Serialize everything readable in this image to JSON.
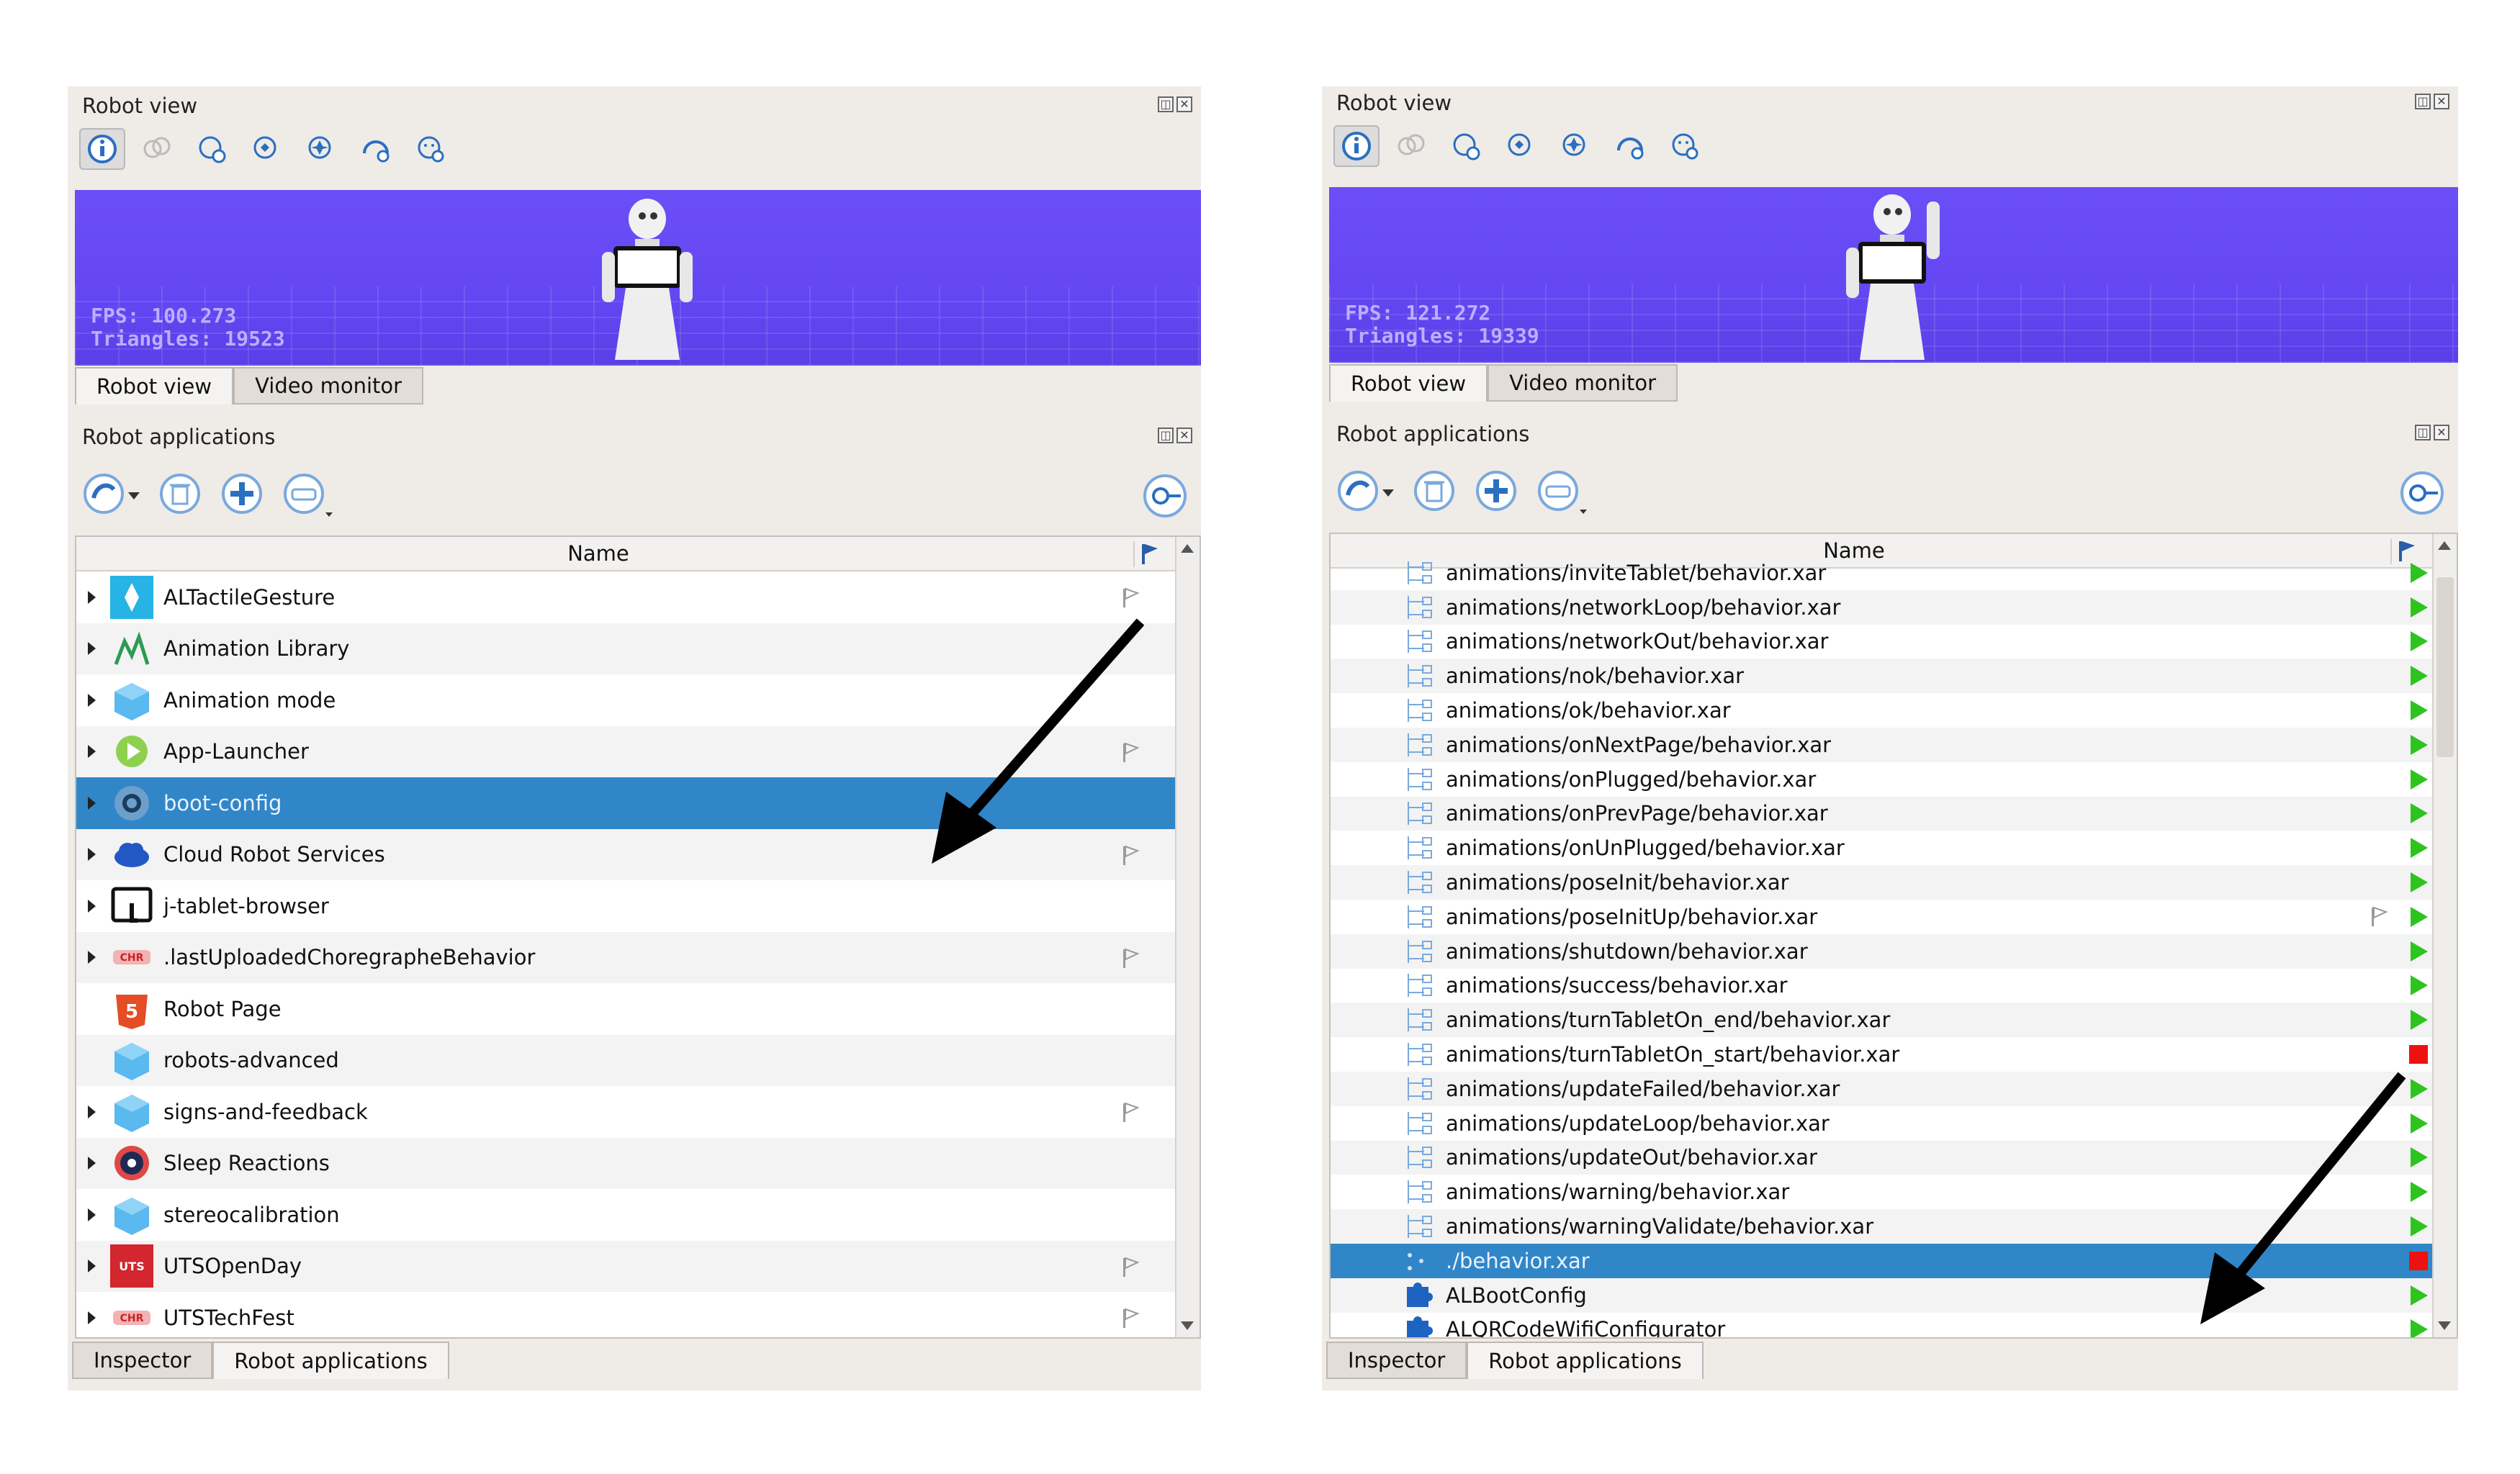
{
  "left": {
    "robot_view_title": "Robot view",
    "fps": "FPS: 100.273",
    "triangles": "Triangles: 19523",
    "tabs_top": [
      "Robot view",
      "Video monitor"
    ],
    "apps_title": "Robot applications",
    "column_name": "Name",
    "apps": [
      {
        "label": "ALTactileGesture",
        "icon": "tactile-gesture-icon",
        "expandable": true,
        "flag": true
      },
      {
        "label": "Animation Library",
        "icon": "animation-library-icon",
        "expandable": true,
        "flag": false
      },
      {
        "label": "Animation mode",
        "icon": "cube-icon",
        "expandable": true,
        "flag": false
      },
      {
        "label": "App-Launcher",
        "icon": "app-launcher-icon",
        "expandable": true,
        "flag": true
      },
      {
        "label": "boot-config",
        "icon": "gear-icon",
        "expandable": true,
        "flag": false,
        "selected": true
      },
      {
        "label": "Cloud Robot Services",
        "icon": "cloud-icon",
        "expandable": true,
        "flag": true
      },
      {
        "label": "j-tablet-browser",
        "icon": "tablet-touch-icon",
        "expandable": true,
        "flag": false
      },
      {
        "label": ".lastUploadedChoregrapheBehavior",
        "icon": "choregraphe-icon",
        "expandable": true,
        "flag": true
      },
      {
        "label": "Robot Page",
        "icon": "html5-icon",
        "expandable": false,
        "flag": false
      },
      {
        "label": "robots-advanced",
        "icon": "cube-icon",
        "expandable": false,
        "flag": false
      },
      {
        "label": "signs-and-feedback",
        "icon": "cube-icon",
        "expandable": true,
        "flag": true
      },
      {
        "label": "Sleep Reactions",
        "icon": "sleep-reactions-icon",
        "expandable": true,
        "flag": false
      },
      {
        "label": "stereocalibration",
        "icon": "cube-icon",
        "expandable": true,
        "flag": false
      },
      {
        "label": "UTSOpenDay",
        "icon": "uts-icon",
        "expandable": true,
        "flag": true
      },
      {
        "label": "UTSTechFest",
        "icon": "choregraphe-icon",
        "expandable": true,
        "flag": true
      }
    ],
    "tabs_bottom": [
      "Inspector",
      "Robot applications"
    ]
  },
  "right": {
    "robot_view_title": "Robot view",
    "fps": "FPS: 121.272",
    "triangles": "Triangles: 19339",
    "tabs_top": [
      "Robot view",
      "Video monitor"
    ],
    "apps_title": "Robot applications",
    "column_name": "Name",
    "behaviors": [
      {
        "label": "animations/inviteTablet/behavior.xar",
        "status": "play",
        "partial": true
      },
      {
        "label": "animations/networkLoop/behavior.xar",
        "status": "play"
      },
      {
        "label": "animations/networkOut/behavior.xar",
        "status": "play"
      },
      {
        "label": "animations/nok/behavior.xar",
        "status": "play"
      },
      {
        "label": "animations/ok/behavior.xar",
        "status": "play"
      },
      {
        "label": "animations/onNextPage/behavior.xar",
        "status": "play"
      },
      {
        "label": "animations/onPlugged/behavior.xar",
        "status": "play"
      },
      {
        "label": "animations/onPrevPage/behavior.xar",
        "status": "play"
      },
      {
        "label": "animations/onUnPlugged/behavior.xar",
        "status": "play"
      },
      {
        "label": "animations/poseInit/behavior.xar",
        "status": "play"
      },
      {
        "label": "animations/poseInitUp/behavior.xar",
        "status": "play",
        "flag": true
      },
      {
        "label": "animations/shutdown/behavior.xar",
        "status": "play"
      },
      {
        "label": "animations/success/behavior.xar",
        "status": "play"
      },
      {
        "label": "animations/turnTabletOn_end/behavior.xar",
        "status": "play"
      },
      {
        "label": "animations/turnTabletOn_start/behavior.xar",
        "status": "stop"
      },
      {
        "label": "animations/updateFailed/behavior.xar",
        "status": "play"
      },
      {
        "label": "animations/updateLoop/behavior.xar",
        "status": "play"
      },
      {
        "label": "animations/updateOut/behavior.xar",
        "status": "play"
      },
      {
        "label": "animations/warning/behavior.xar",
        "status": "play"
      },
      {
        "label": "animations/warningValidate/behavior.xar",
        "status": "play"
      },
      {
        "label": "./behavior.xar",
        "status": "stop",
        "selected": true
      },
      {
        "label": "ALBootConfig",
        "status": "play",
        "puzzle": true
      },
      {
        "label": "ALQRCodeWifiConfigurator",
        "status": "play",
        "puzzle": true
      }
    ],
    "tabs_bottom": [
      "Inspector",
      "Robot applications"
    ]
  },
  "colors": {
    "viewport": "#6a4df5",
    "selection": "#3186c7",
    "play": "#2ec41f",
    "stop": "#ee1111"
  }
}
